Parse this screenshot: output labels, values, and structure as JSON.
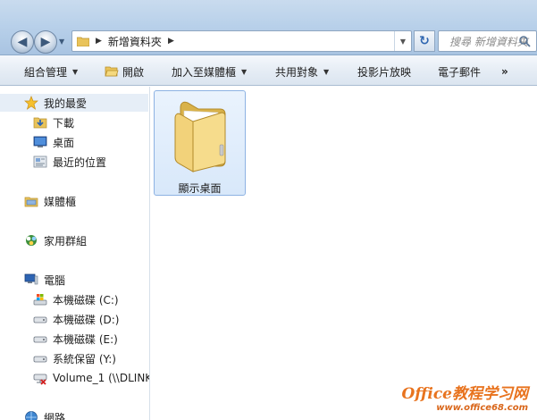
{
  "address_bar": {
    "path": "新增資料夾"
  },
  "search": {
    "placeholder": "搜尋 新增資料夾"
  },
  "command_bar": {
    "organize": "組合管理",
    "open": "開啟",
    "add_to_library": "加入至媒體櫃",
    "share_with": "共用對象",
    "slideshow": "投影片放映",
    "email": "電子郵件",
    "more": "»"
  },
  "nav_pane": {
    "favorites": "我的最愛",
    "downloads": "下載",
    "desktop": "桌面",
    "recent_places": "最近的位置",
    "libraries": "媒體櫃",
    "homegroup": "家用群組",
    "computer": "電腦",
    "drives": [
      {
        "label": "本機磁碟 (C:)"
      },
      {
        "label": "本機磁碟 (D:)"
      },
      {
        "label": "本機磁碟 (E:)"
      },
      {
        "label": "系統保留 (Y:)"
      },
      {
        "label": "Volume_1 (\\\\DLINK"
      }
    ],
    "network": "網路"
  },
  "content": {
    "items": [
      {
        "label": "顯示桌面",
        "icon": "folder-icon",
        "selected": true
      }
    ]
  },
  "watermark": {
    "line1": "Office教程学习网",
    "line2": "www.office68.com"
  },
  "colors": {
    "accent": "#2f66b0",
    "selection": "#d8e8fa",
    "watermark": "#e8731e"
  }
}
